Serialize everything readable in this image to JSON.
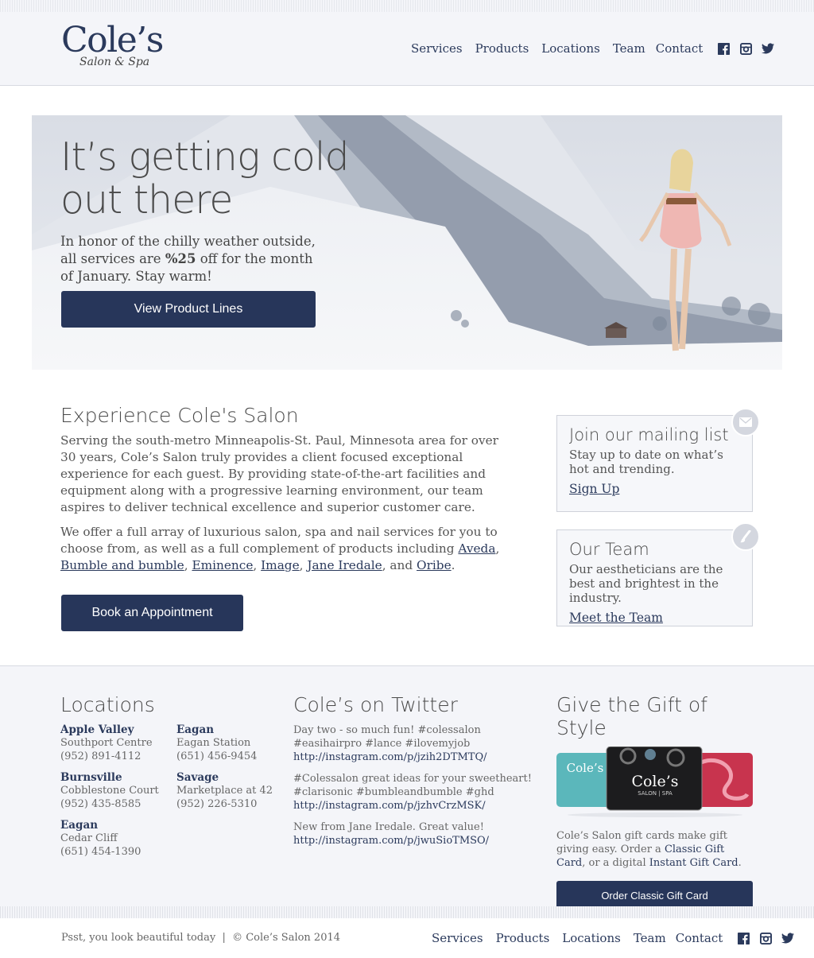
{
  "header": {
    "logo": "Cole’s",
    "logo_sub": "Salon & Spa",
    "nav": [
      "Services",
      "Products",
      "Locations",
      "Team",
      "Contact"
    ]
  },
  "hero": {
    "title_line1": "It’s getting cold",
    "title_line2": "out there",
    "text_a": "In honor of the chilly weather outside, all services are ",
    "text_bold": "%25",
    "text_b": " off for the month of January. Stay warm!",
    "button": "View Product Lines"
  },
  "experience": {
    "title": "Experience Cole's Salon",
    "para1": "Serving the south-metro Minneapolis-St. Paul, Minnesota area for over 30 years, Cole’s Salon truly provides a client focused exceptional experience for each guest. By providing state-of-the-art facilities and equipment along with a progressive learning environment, our team aspires to deliver technical excellence and superior customer care.",
    "para2_start": "We offer a full array of luxurious salon, spa and nail services for you to choose from, as well as a full complement of products including ",
    "brands": [
      "Aveda",
      "Bumble and bumble",
      "Eminence",
      "Image",
      "Jane Iredale",
      "Oribe"
    ],
    "and_text": ", and ",
    "comma": ", ",
    "period": ".",
    "button": "Book an Appointment"
  },
  "mailing": {
    "title": "Join our mailing list",
    "text": "Stay up to date on what’s hot and trending.",
    "link": "Sign Up"
  },
  "team": {
    "title": "Our Team",
    "text": "Our aestheticians are the best and brightest in the industry.",
    "link": "Meet the Team"
  },
  "locations": {
    "title": "Locations",
    "items": [
      {
        "city": "Apple Valley",
        "place": "Southport Centre",
        "phone": "(952) 891-4112"
      },
      {
        "city": "Eagan",
        "place": "Eagan Station",
        "phone": "(651) 456-9454"
      },
      {
        "city": "Burnsville",
        "place": "Cobblestone Court",
        "phone": "(952) 435-8585"
      },
      {
        "city": "Savage",
        "place": "Marketplace at 42",
        "phone": "(952) 226-5310"
      },
      {
        "city": "Eagan",
        "place": "Cedar Cliff",
        "phone": "(651) 454-1390"
      }
    ]
  },
  "twitter": {
    "title": "Cole’s on Twitter",
    "tweets": [
      {
        "text": "Day two - so much fun! #colessalon #easihairpro #lance #ilovemyjob",
        "link": "http://instagram.com/p/jzih2DTMTQ/"
      },
      {
        "text": "#Colessalon great ideas for your sweetheart! #clarisonic #bumbleandbumble #ghd",
        "link": "http://instagram.com/p/jzhvCrzMSK/"
      },
      {
        "text": "New from Jane Iredale. Great value!",
        "link": "http://instagram.com/p/jwuSioTMSO/"
      }
    ]
  },
  "gift": {
    "title": "Give the Gift of Style",
    "card_logo": "Cole’s",
    "card_sub": "SALON | SPA",
    "text_a": "Cole’s Salon gift cards make gift giving easy. Order a ",
    "link_classic": "Classic Gift Card",
    "text_b": ", or a digital ",
    "link_instant": "Instant Gift Card",
    "text_c": ".",
    "button": "Order Classic Gift Card"
  },
  "footer": {
    "left": "Psst, you look beautiful today  |  © Cole’s Salon 2014",
    "nav": [
      "Services",
      "Products",
      "Locations",
      "Team",
      "Contact"
    ]
  },
  "colors": {
    "navy": "#27365a",
    "accent": "#2b3a5c",
    "footer_bg": "#f4f5f9"
  }
}
